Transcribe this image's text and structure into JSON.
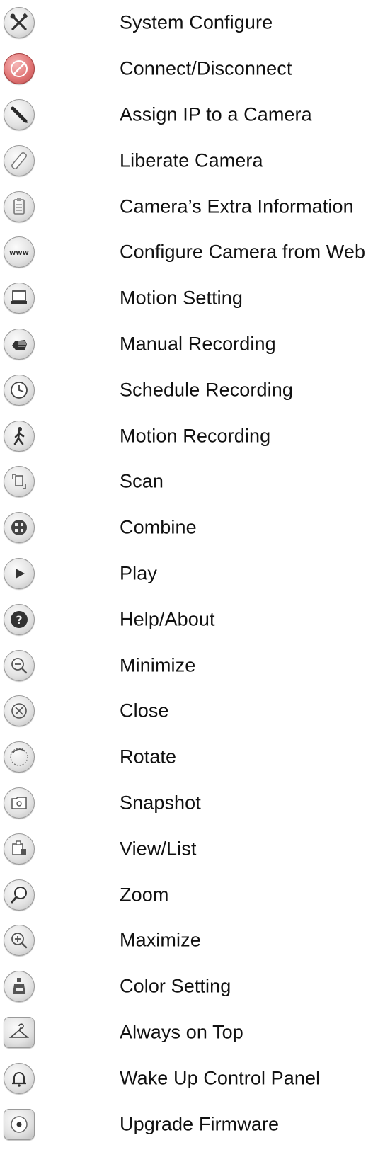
{
  "items": [
    {
      "label": "System Configure",
      "icon": "tools-icon"
    },
    {
      "label": "Connect/Disconnect",
      "icon": "plug-icon"
    },
    {
      "label": "Assign IP to a Camera",
      "icon": "pen-icon"
    },
    {
      "label": "Liberate Camera",
      "icon": "eraser-icon"
    },
    {
      "label": "Camera’s Extra Information",
      "icon": "clipboard-icon"
    },
    {
      "label": "Configure Camera from Web",
      "icon": "www-icon"
    },
    {
      "label": "Motion Setting",
      "icon": "monitor-icon"
    },
    {
      "label": "Manual Recording",
      "icon": "hand-icon"
    },
    {
      "label": "Schedule Recording",
      "icon": "clock-icon"
    },
    {
      "label": "Motion Recording",
      "icon": "walking-person-icon"
    },
    {
      "label": "Scan",
      "icon": "scan-icon"
    },
    {
      "label": "Combine",
      "icon": "combine-icon"
    },
    {
      "label": "Play",
      "icon": "play-icon"
    },
    {
      "label": "Help/About",
      "icon": "help-icon"
    },
    {
      "label": "Minimize",
      "icon": "zoom-out-icon"
    },
    {
      "label": "Close",
      "icon": "close-icon"
    },
    {
      "label": "Rotate",
      "icon": "rotate-icon"
    },
    {
      "label": "Snapshot",
      "icon": "snapshot-icon"
    },
    {
      "label": "View/List",
      "icon": "view-list-icon"
    },
    {
      "label": "Zoom",
      "icon": "magnifier-icon"
    },
    {
      "label": "Maximize",
      "icon": "zoom-in-icon"
    },
    {
      "label": "Color Setting",
      "icon": "color-bottle-icon"
    },
    {
      "label": "Always on Top",
      "icon": "hanger-icon"
    },
    {
      "label": "Wake Up Control Panel",
      "icon": "bell-icon"
    },
    {
      "label": "Upgrade Firmware",
      "icon": "disc-icon"
    }
  ]
}
